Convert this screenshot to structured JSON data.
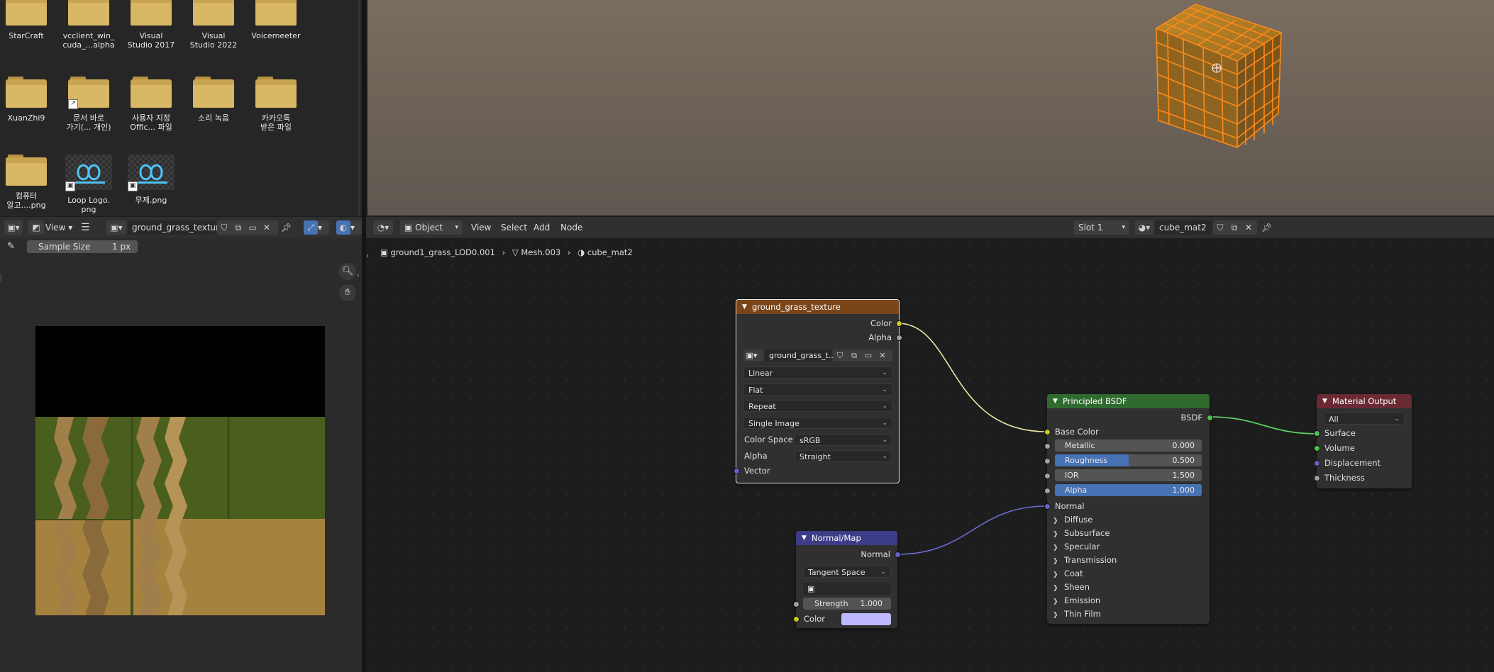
{
  "desktop": {
    "items": [
      {
        "label": "StarCraft",
        "type": "folder"
      },
      {
        "label": "vcclient_win_\ncuda_...alpha",
        "type": "folder"
      },
      {
        "label": "Visual\nStudio 2017",
        "type": "folder"
      },
      {
        "label": "Visual\nStudio 2022",
        "type": "folder"
      },
      {
        "label": "Voicemeeter",
        "type": "folder"
      },
      {
        "label": "XuanZhi9",
        "type": "folder"
      },
      {
        "label": "문서 바로\n가기(... 개인)",
        "type": "folder-shortcut"
      },
      {
        "label": "사용자 지정\nOffic... 파일",
        "type": "folder"
      },
      {
        "label": "소리 녹음",
        "type": "folder"
      },
      {
        "label": "카카오톡\n받은 파일",
        "type": "folder"
      },
      {
        "label": "컴퓨터\n알고....png",
        "type": "folder"
      },
      {
        "label": "Loop Logo.\npng",
        "type": "image"
      },
      {
        "label": "무제.png",
        "type": "image"
      }
    ]
  },
  "image_editor": {
    "view_menu": "View",
    "image_name": "ground_grass_texture",
    "sample_size_label": "Sample Size",
    "sample_size_value": "1 px"
  },
  "node_editor": {
    "mode": "Object",
    "menus": [
      "View",
      "Select",
      "Add",
      "Node"
    ],
    "slot": "Slot 1",
    "material": "cube_mat2",
    "breadcrumb": [
      "ground1_grass_LOD0.001",
      "Mesh.003",
      "cube_mat2"
    ],
    "image_node": {
      "title": "ground_grass_texture",
      "out_color": "Color",
      "out_alpha": "Alpha",
      "image_field": "ground_grass_t...",
      "interpolation": "Linear",
      "projection": "Flat",
      "extension": "Repeat",
      "source": "Single Image",
      "color_space_label": "Color Space",
      "color_space": "sRGB",
      "alpha_label": "Alpha",
      "alpha_mode": "Straight",
      "in_vector": "Vector",
      "header_color": "#7a4519"
    },
    "bsdf_node": {
      "title": "Principled BSDF",
      "out": "BSDF",
      "base_color": "Base Color",
      "metallic_label": "Metallic",
      "metallic": "0.000",
      "roughness_label": "Roughness",
      "roughness": "0.500",
      "roughness_fraction": 0.5,
      "ior_label": "IOR",
      "ior": "1.500",
      "alpha_label": "Alpha",
      "alpha": "1.000",
      "alpha_fraction": 1.0,
      "normal": "Normal",
      "panels": [
        "Diffuse",
        "Subsurface",
        "Specular",
        "Transmission",
        "Coat",
        "Sheen",
        "Emission",
        "Thin Film"
      ],
      "header_color": "#2f6b2f"
    },
    "output_node": {
      "title": "Material Output",
      "target": "All",
      "inputs": [
        "Surface",
        "Volume",
        "Displacement",
        "Thickness"
      ],
      "header_color": "#6b2a33"
    },
    "normal_node": {
      "title": "Normal/Map",
      "out": "Normal",
      "space": "Tangent Space",
      "strength_label": "Strength",
      "strength": "1.000",
      "color_label": "Color",
      "color_swatch": "#bdb8ff",
      "header_color": "#3c3c88"
    }
  }
}
